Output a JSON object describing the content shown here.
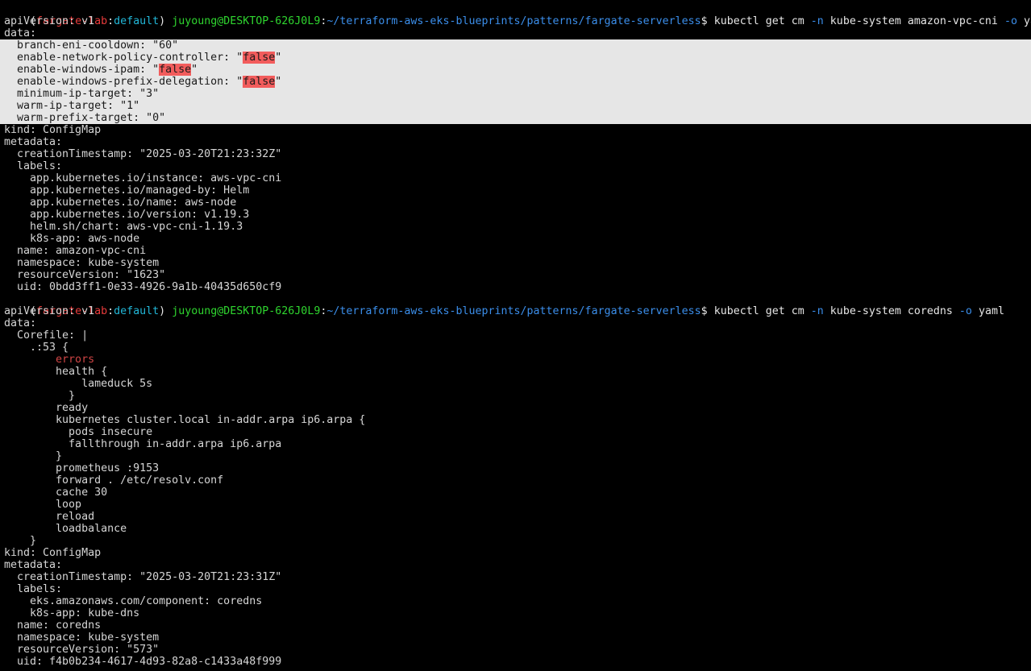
{
  "prompt": {
    "open_paren": "(",
    "context": "fargate-lab",
    "colon": ":",
    "namespace": "default",
    "close_paren": ")",
    "user_host": "juyoung@DESKTOP-626J0L9",
    "path": "~/terraform-aws-eks-blueprints/patterns/fargate-serverless",
    "dollar": "$"
  },
  "commands": [
    {
      "base": " kubectl get cm ",
      "flag1": "-n",
      "mid": " kube-system amazon-vpc-cni ",
      "flag2": "-o",
      "tail": " yaml"
    },
    {
      "base": " kubectl get cm ",
      "flag1": "-n",
      "mid": " kube-system coredns ",
      "flag2": "-o",
      "tail": " yaml"
    }
  ],
  "vpc_cni": {
    "api_version": "apiVersion: v1",
    "data_key": "data:",
    "data_lines": [
      {
        "pre": "  branch-eni-cooldown: \"60\"",
        "val": "",
        "post": ""
      },
      {
        "pre": "  enable-network-policy-controller: \"",
        "val": "false",
        "post": "\""
      },
      {
        "pre": "  enable-windows-ipam: \"",
        "val": "false",
        "post": "\""
      },
      {
        "pre": "  enable-windows-prefix-delegation: \"",
        "val": "false",
        "post": "\""
      },
      {
        "pre": "  minimum-ip-target: \"3\"",
        "val": "",
        "post": ""
      },
      {
        "pre": "  warm-ip-target: \"1\"",
        "val": "",
        "post": ""
      },
      {
        "pre": "  warm-prefix-target: \"0\"",
        "val": "",
        "post": ""
      }
    ],
    "meta_lines": [
      "kind: ConfigMap",
      "metadata:",
      "  creationTimestamp: \"2025-03-20T21:23:32Z\"",
      "  labels:",
      "    app.kubernetes.io/instance: aws-vpc-cni",
      "    app.kubernetes.io/managed-by: Helm",
      "    app.kubernetes.io/name: aws-node",
      "    app.kubernetes.io/version: v1.19.3",
      "    helm.sh/chart: aws-vpc-cni-1.19.3",
      "    k8s-app: aws-node",
      "  name: amazon-vpc-cni",
      "  namespace: kube-system",
      "  resourceVersion: \"1623\"",
      "  uid: 0bdd3ff1-0e33-4926-9a1b-40435d650cf9"
    ]
  },
  "coredns": {
    "lines_before": [
      "apiVersion: v1",
      "data:",
      "  Corefile: |",
      "    .:53 {"
    ],
    "errors_line": "        errors",
    "lines_after": [
      "        health {",
      "            lameduck 5s",
      "          }",
      "        ready",
      "        kubernetes cluster.local in-addr.arpa ip6.arpa {",
      "          pods insecure",
      "          fallthrough in-addr.arpa ip6.arpa",
      "        }",
      "        prometheus :9153",
      "        forward . /etc/resolv.conf",
      "        cache 30",
      "        loop",
      "        reload",
      "        loadbalance",
      "    }",
      "kind: ConfigMap",
      "metadata:",
      "  creationTimestamp: \"2025-03-20T21:23:31Z\"",
      "  labels:",
      "    eks.amazonaws.com/component: coredns",
      "    k8s-app: kube-dns",
      "  name: coredns",
      "  namespace: kube-system",
      "  resourceVersion: \"573\"",
      "  uid: f4b0b234-4617-4d93-82a8-c1433a48f999"
    ]
  },
  "colors": {
    "background": "#000000",
    "text": "#d6d6d6",
    "context": "#e83b3b",
    "user_host": "#2fd62f",
    "path": "#22b7d8",
    "flag": "#3b8eea",
    "highlight_band": "#e6e6e6",
    "false_highlight": "#f25c5c"
  }
}
